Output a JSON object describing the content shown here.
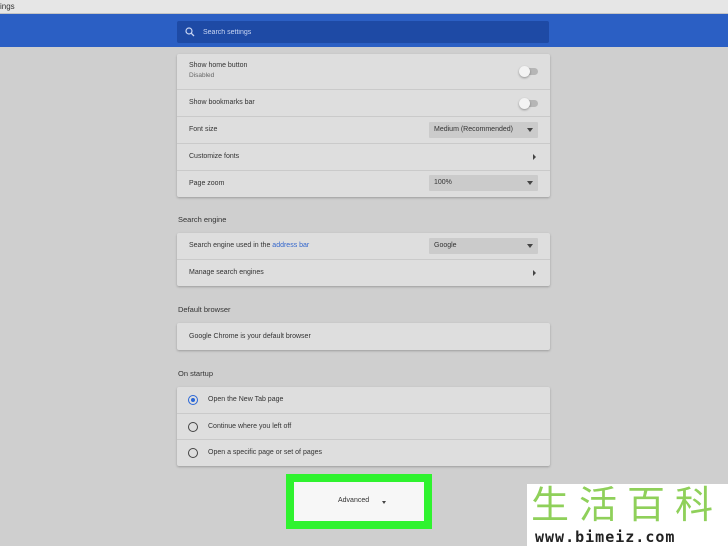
{
  "window": {
    "title_fragment": "ings"
  },
  "search": {
    "placeholder": "Search settings",
    "icon": "search-icon"
  },
  "appearance": {
    "home_button": {
      "label": "Show home button",
      "status": "Disabled"
    },
    "bookmarks_bar": {
      "label": "Show bookmarks bar"
    },
    "font_size": {
      "label": "Font size",
      "value": "Medium (Recommended)"
    },
    "customize_fonts": {
      "label": "Customize fonts"
    },
    "page_zoom": {
      "label": "Page zoom",
      "value": "100%"
    }
  },
  "search_engine": {
    "section_title": "Search engine",
    "engine_row": {
      "label_prefix": "Search engine used in the ",
      "link": "address bar",
      "value": "Google"
    },
    "manage": {
      "label": "Manage search engines"
    }
  },
  "default_browser": {
    "section_title": "Default browser",
    "status": "Google Chrome is your default browser"
  },
  "on_startup": {
    "section_title": "On startup",
    "options": [
      {
        "label": "Open the New Tab page",
        "selected": true
      },
      {
        "label": "Continue where you left off",
        "selected": false
      },
      {
        "label": "Open a specific page or set of pages",
        "selected": false
      }
    ]
  },
  "advanced": {
    "label": "Advanced",
    "highlight_color": "#2ff32f"
  },
  "colors": {
    "header": "#2b5fc4",
    "search_bg": "#1e4aa5",
    "accent": "#2b67d6",
    "link": "#3366cc"
  },
  "watermark": {
    "text": "生活百科",
    "url": "www.bimeiz.com"
  }
}
